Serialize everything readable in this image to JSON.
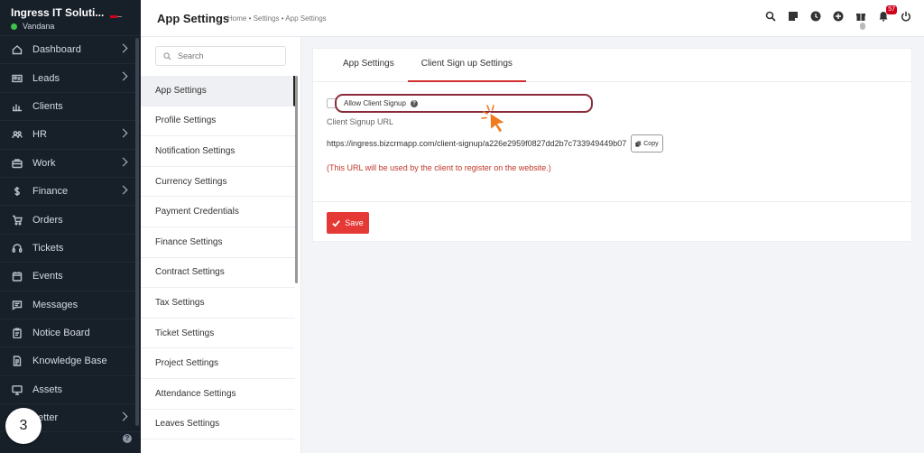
{
  "sidebar": {
    "company": "Ingress IT Soluti...",
    "user": "Vandana",
    "items": [
      {
        "label": "Dashboard",
        "icon": "home-icon",
        "chevron": true
      },
      {
        "label": "Leads",
        "icon": "id-card-icon",
        "chevron": true
      },
      {
        "label": "Clients",
        "icon": "chart-icon",
        "chevron": false
      },
      {
        "label": "HR",
        "icon": "people-icon",
        "chevron": true
      },
      {
        "label": "Work",
        "icon": "briefcase-icon",
        "chevron": true
      },
      {
        "label": "Finance",
        "icon": "dollar-icon",
        "chevron": true
      },
      {
        "label": "Orders",
        "icon": "cart-icon",
        "chevron": false
      },
      {
        "label": "Tickets",
        "icon": "headset-icon",
        "chevron": false
      },
      {
        "label": "Events",
        "icon": "calendar-icon",
        "chevron": false
      },
      {
        "label": "Messages",
        "icon": "message-icon",
        "chevron": false
      },
      {
        "label": "Notice Board",
        "icon": "clipboard-icon",
        "chevron": false
      },
      {
        "label": "Knowledge Base",
        "icon": "document-icon",
        "chevron": false
      },
      {
        "label": "Assets",
        "icon": "monitor-icon",
        "chevron": false
      },
      {
        "label": "Letter",
        "icon": "letter-icon",
        "chevron": true
      }
    ],
    "step_number": "3"
  },
  "header": {
    "title": "App Settings",
    "breadcrumb": "Home • Settings • App Settings",
    "notification_count": "57"
  },
  "submenu": {
    "search_placeholder": "Search",
    "items": [
      "App Settings",
      "Profile Settings",
      "Notification Settings",
      "Currency Settings",
      "Payment Credentials",
      "Finance Settings",
      "Contract Settings",
      "Tax Settings",
      "Ticket Settings",
      "Project Settings",
      "Attendance Settings",
      "Leaves Settings"
    ]
  },
  "card": {
    "tabs": [
      "App Settings",
      "Client Sign up Settings"
    ],
    "active_tab": 1,
    "checkbox_label": "Allow Client Signup",
    "url_label": "Client Signup URL",
    "url_value": "https://ingress.bizcrmapp.com/client-signup/a226e2959f0827dd2b7c733949449b07",
    "copy_label": "Copy",
    "url_note": "(This URL will be used by the client to register on the website.)",
    "save_label": "Save"
  },
  "colors": {
    "sidebar_bg": "#171f29",
    "accent_red": "#e53935",
    "highlight_border": "#8b2a3a",
    "cursor_orange": "#f07a1e"
  }
}
